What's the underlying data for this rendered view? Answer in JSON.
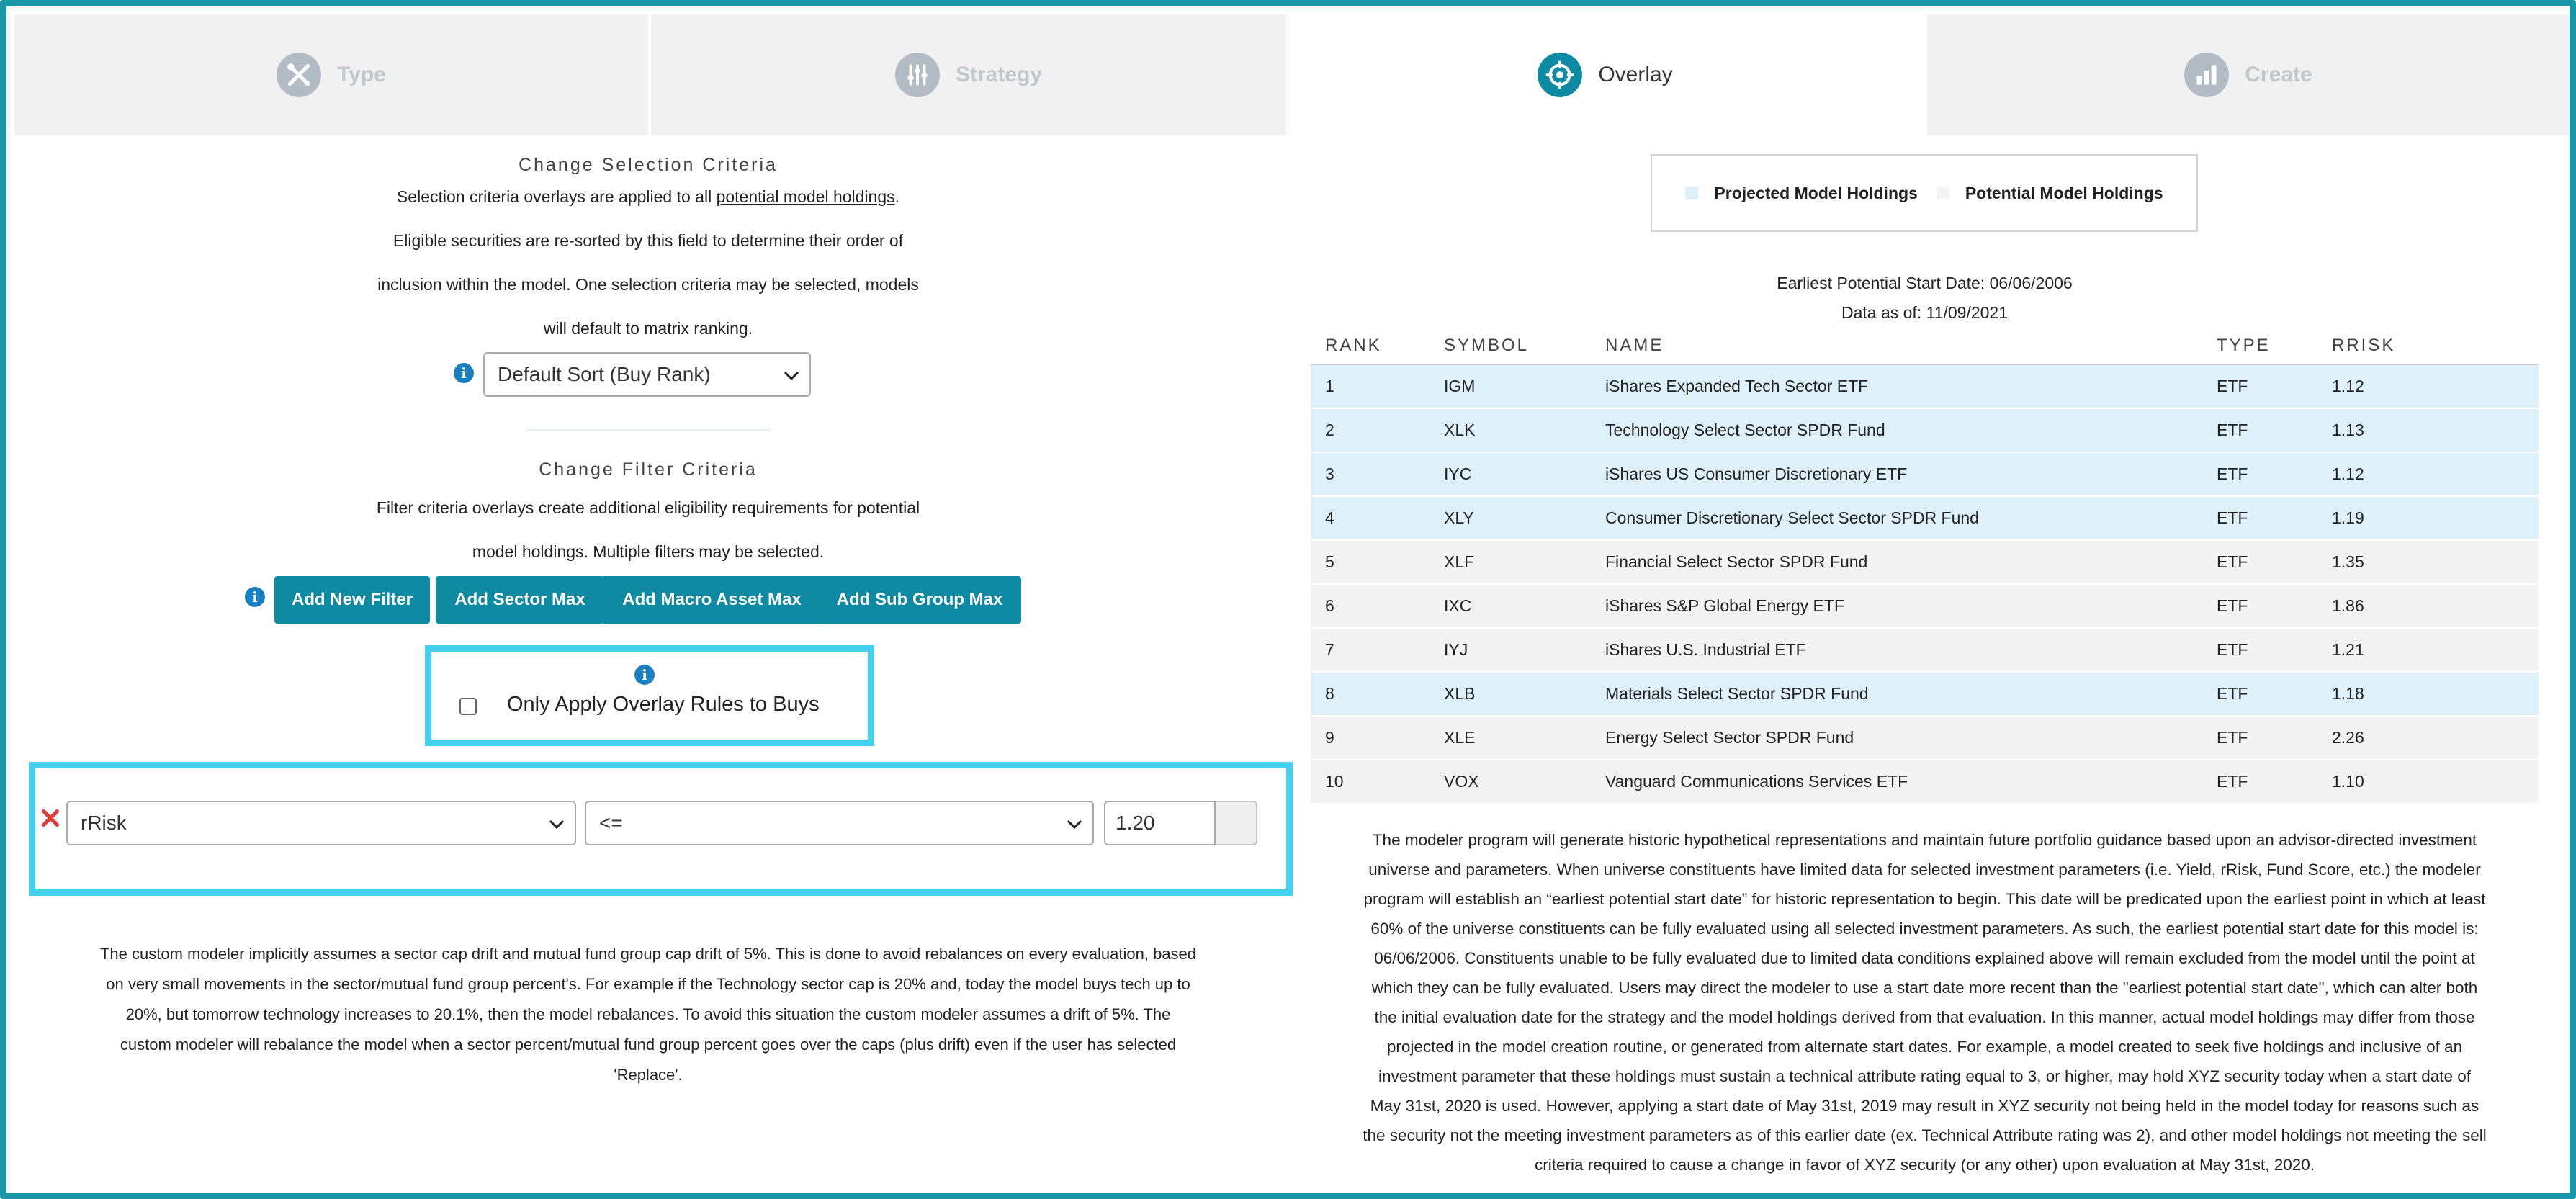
{
  "tabs": [
    {
      "label": "Type",
      "icon": "wrench-icon",
      "active": false
    },
    {
      "label": "Strategy",
      "icon": "sliders-icon",
      "active": false
    },
    {
      "label": "Overlay",
      "icon": "target-icon",
      "active": true
    },
    {
      "label": "Create",
      "icon": "bar-chart-icon",
      "active": false
    }
  ],
  "selection": {
    "heading": "Change Selection Criteria",
    "line1_prefix": "Selection criteria overlays are applied to all ",
    "line1_link": "potential model holdings",
    "line1_suffix": ".",
    "line2": "Eligible securities are re-sorted by this field to determine their order of",
    "line3": "inclusion within the model. One selection criteria may be selected, models",
    "line4": "will default to matrix ranking.",
    "sort_value": "Default Sort (Buy Rank)"
  },
  "filter": {
    "heading": "Change Filter Criteria",
    "line1": "Filter criteria overlays create additional eligibility requirements for potential",
    "line2": "model holdings. Multiple filters may be selected.",
    "buttons": [
      "Add New Filter",
      "Add Sector Max",
      "Add Macro Asset Max",
      "Add Sub Group Max"
    ],
    "only_buys_label": "Only Apply Overlay Rules to Buys",
    "only_buys_checked": false,
    "rule": {
      "field": "rRisk",
      "operator": "<=",
      "value": "1.20"
    }
  },
  "note": {
    "line1": "The custom modeler implicitly assumes a sector cap drift and mutual fund group cap drift of 5%. This is done to avoid rebalances on every evaluation, based",
    "line2": "on very small movements in the sector/mutual fund group percent's. For example if the Technology sector cap is 20% and, today the model buys tech up to",
    "line3": "20%, but tomorrow technology increases to 20.1%, then the model rebalances. To avoid this situation the custom modeler assumes a drift of 5%. The",
    "line4": "custom modeler will rebalance the model when a sector percent/mutual fund group percent goes over the caps (plus drift) even if the user has selected",
    "line5": "'Replace'."
  },
  "legend": {
    "projected": "Projected Model Holdings",
    "potential": "Potential Model Holdings",
    "projected_color": "#def1fa",
    "potential_color": "#f3f3f3"
  },
  "meta": {
    "start_date": "Earliest Potential Start Date: 06/06/2006",
    "as_of": "Data as of: 11/09/2021"
  },
  "table": {
    "headers": [
      "RANK",
      "SYMBOL",
      "NAME",
      "TYPE",
      "RRISK"
    ],
    "rows": [
      {
        "rank": "1",
        "symbol": "IGM",
        "name": "iShares Expanded Tech Sector ETF",
        "type": "ETF",
        "rrisk": "1.12",
        "projected": true
      },
      {
        "rank": "2",
        "symbol": "XLK",
        "name": "Technology Select Sector SPDR Fund",
        "type": "ETF",
        "rrisk": "1.13",
        "projected": true
      },
      {
        "rank": "3",
        "symbol": "IYC",
        "name": "iShares US Consumer Discretionary ETF",
        "type": "ETF",
        "rrisk": "1.12",
        "projected": true
      },
      {
        "rank": "4",
        "symbol": "XLY",
        "name": "Consumer Discretionary Select Sector SPDR Fund",
        "type": "ETF",
        "rrisk": "1.19",
        "projected": true
      },
      {
        "rank": "5",
        "symbol": "XLF",
        "name": "Financial Select Sector SPDR Fund",
        "type": "ETF",
        "rrisk": "1.35",
        "projected": false
      },
      {
        "rank": "6",
        "symbol": "IXC",
        "name": "iShares S&P Global Energy ETF",
        "type": "ETF",
        "rrisk": "1.86",
        "projected": false
      },
      {
        "rank": "7",
        "symbol": "IYJ",
        "name": "iShares U.S. Industrial ETF",
        "type": "ETF",
        "rrisk": "1.21",
        "projected": false
      },
      {
        "rank": "8",
        "symbol": "XLB",
        "name": "Materials Select Sector SPDR Fund",
        "type": "ETF",
        "rrisk": "1.18",
        "projected": true
      },
      {
        "rank": "9",
        "symbol": "XLE",
        "name": "Energy Select Sector SPDR Fund",
        "type": "ETF",
        "rrisk": "2.26",
        "projected": false
      },
      {
        "rank": "10",
        "symbol": "VOX",
        "name": "Vanguard Communications Services ETF",
        "type": "ETF",
        "rrisk": "1.10",
        "projected": false
      }
    ]
  },
  "disclaimer": [
    "The modeler program will generate historic hypothetical representations and maintain future portfolio guidance based upon an advisor-directed investment",
    "universe and parameters. When universe constituents have limited data for selected investment parameters (i.e. Yield, rRisk, Fund Score, etc.) the modeler",
    "program will establish an “earliest potential start date” for historic representation to begin. This date will be predicated upon the earliest point in which at least",
    "60% of the universe constituents can be fully evaluated using all selected investment parameters. As such, the earliest potential start date for this model is:",
    "06/06/2006. Constituents unable to be fully evaluated due to limited data conditions explained above will remain excluded from the model until the point at",
    "which they can be fully evaluated. Users may direct the modeler to use a start date more recent than the \"earliest potential start date\", which can alter both",
    "the initial evaluation date for the strategy and the model holdings derived from that evaluation. In this manner, actual model holdings may differ from those",
    "projected in the model creation routine, or generated from alternate start dates. For example, a model created to seek five holdings and inclusive of an",
    "investment parameter that these holdings must sustain a technical attribute rating equal to 3, or higher, may hold XYZ security today when a start date of",
    "May 31st, 2020 is used. However, applying a start date of May 31st, 2019 may result in XYZ security not being held in the model today for reasons such as",
    "the security not the meeting investment parameters as of this earlier date (ex. Technical Attribute rating was 2), and other model holdings not meeting the sell",
    "criteria required to cause a change in favor of XYZ security (or any other) upon evaluation at May 31st, 2020."
  ]
}
